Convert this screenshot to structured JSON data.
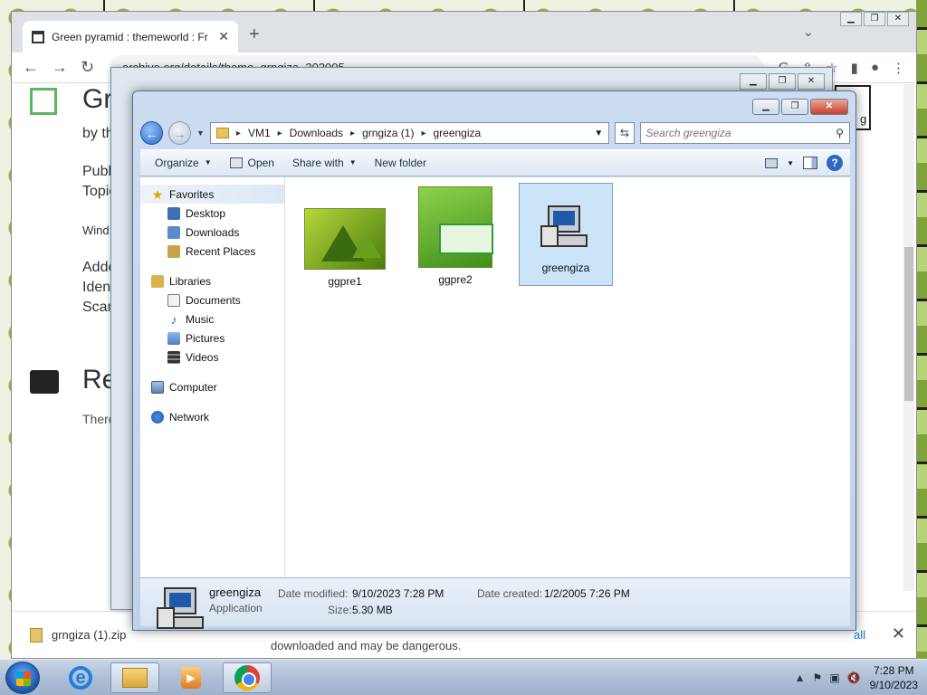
{
  "chrome": {
    "tab_title": "Green pyramid : themeworld : Fr",
    "url": "archive.org/details/theme_grngiza_202005",
    "page": {
      "title_fragment": "Gr",
      "by_fragment": "by th",
      "line1": "Publ",
      "line2": "Topic",
      "line3": "Wind",
      "line4": "Adde",
      "line5": "Ident",
      "line6": "Scan",
      "reviews_fragment": "Re",
      "there_fragment": "There"
    },
    "download": {
      "file": "grngiza (1).zip",
      "warning": "downloaded and may be dangerous.",
      "show_all": "all"
    },
    "tip_fragment": "g"
  },
  "explorer": {
    "breadcrumb": [
      "VM1",
      "Downloads",
      "grngiza (1)",
      "greengiza"
    ],
    "search_placeholder": "Search greengiza",
    "commands": {
      "organize": "Organize",
      "open": "Open",
      "share": "Share with",
      "new_folder": "New folder"
    },
    "nav": {
      "favorites": "Favorites",
      "desktop": "Desktop",
      "downloads": "Downloads",
      "recent": "Recent Places",
      "libraries": "Libraries",
      "documents": "Documents",
      "music": "Music",
      "pictures": "Pictures",
      "videos": "Videos",
      "computer": "Computer",
      "network": "Network"
    },
    "files": [
      {
        "name": "ggpre1"
      },
      {
        "name": "ggpre2"
      },
      {
        "name": "greengiza"
      }
    ],
    "details": {
      "name": "greengiza",
      "type": "Application",
      "modified_label": "Date modified:",
      "modified": "9/10/2023 7:28 PM",
      "created_label": "Date created:",
      "created": "1/2/2005 7:26 PM",
      "size_label": "Size:",
      "size": "5.30 MB"
    }
  },
  "taskbar": {
    "time": "7:28 PM",
    "date": "9/10/2023"
  }
}
